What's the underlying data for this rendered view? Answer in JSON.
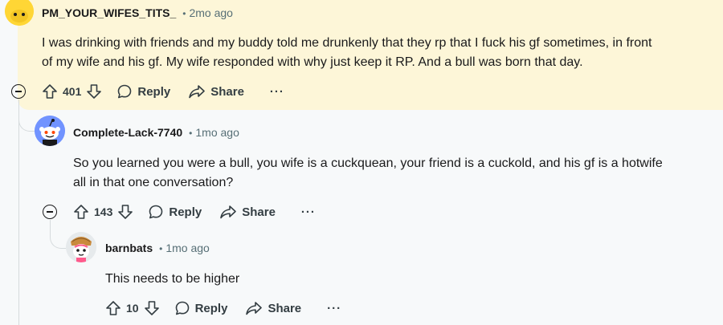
{
  "comments": [
    {
      "username": "PM_YOUR_WIFES_TITS_",
      "separator": "•",
      "time": "2mo ago",
      "text_line1": "I was drinking with friends and my buddy told me drunkenly that they rp that I fuck his gf sometimes, in front",
      "text_line2": "of my wife and his gf. My wife responded with why just keep it RP. And a bull was born that day.",
      "score": "401",
      "reply_label": "Reply",
      "share_label": "Share",
      "more_label": "···",
      "highlight_color": "#fdf6d8"
    },
    {
      "username": "Complete-Lack-7740",
      "separator": "•",
      "time": "1mo ago",
      "text_line1": "So you learned you were a bull, you wife is a cuckquean, your friend is a cuckold, and his gf is a hotwife",
      "text_line2": "all in that one conversation?",
      "score": "143",
      "reply_label": "Reply",
      "share_label": "Share",
      "more_label": "···"
    },
    {
      "username": "barnbats",
      "separator": "•",
      "time": "1mo ago",
      "text_line1": "This needs to be higher",
      "score": "10",
      "reply_label": "Reply",
      "share_label": "Share",
      "more_label": "···"
    }
  ],
  "colors": {
    "background": "#f7f9fa",
    "highlight": "#fdf6d8",
    "meta_gray": "#576f76",
    "thread_line": "#d6dbdd",
    "snoo_blue_avatar": "#7193ff",
    "snoo_yellow_avatar": "#ffd635"
  }
}
